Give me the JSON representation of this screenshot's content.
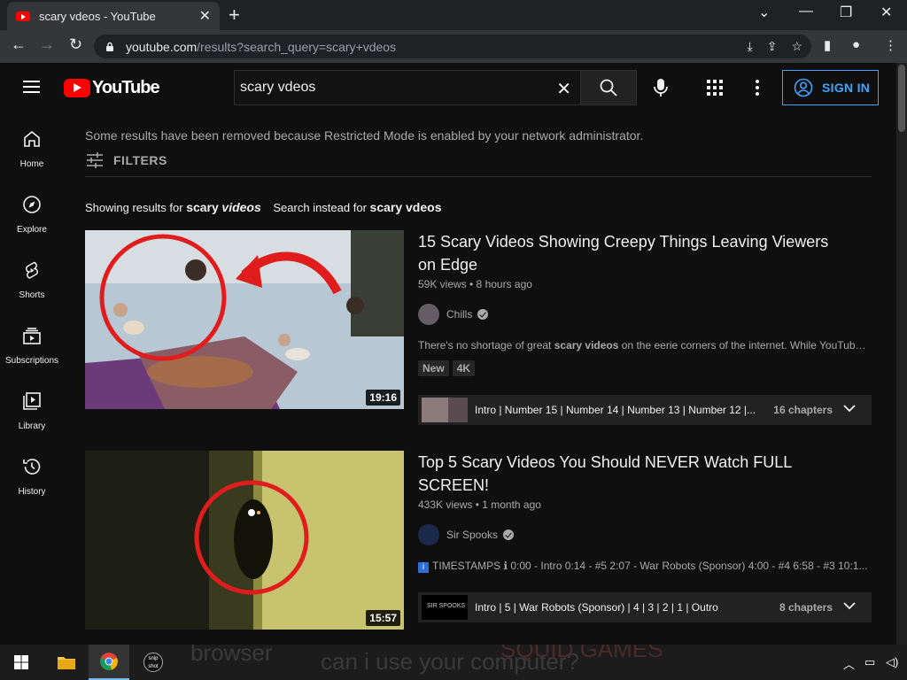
{
  "browser": {
    "tab_title": "scary vdeos - YouTube",
    "url_host": "youtube.com",
    "url_path": "/results?search_query=scary+vdeos"
  },
  "header": {
    "logo_text": "YouTube",
    "search_value": "scary vdeos",
    "sign_in_label": "SIGN IN"
  },
  "sidebar": {
    "items": [
      {
        "label": "Home",
        "icon": "home-icon"
      },
      {
        "label": "Explore",
        "icon": "compass-icon"
      },
      {
        "label": "Shorts",
        "icon": "shorts-icon"
      },
      {
        "label": "Subscriptions",
        "icon": "subscriptions-icon"
      },
      {
        "label": "Library",
        "icon": "library-icon"
      },
      {
        "label": "History",
        "icon": "history-icon"
      }
    ]
  },
  "main": {
    "restricted_notice": "Some results have been removed because Restricted Mode is enabled by your network administrator.",
    "filters_label": "FILTERS",
    "showing_prefix": "Showing results for",
    "showing_query_a": "scary",
    "showing_query_b": "videos",
    "instead_prefix": "Search instead for",
    "instead_query": "scary vdeos"
  },
  "results": [
    {
      "title_line1": "15 Scary Videos Showing Creepy Things Leaving Viewers",
      "title_line2": "on Edge",
      "meta": "59K views • 8 hours ago",
      "channel": "Chills",
      "duration": "19:16",
      "desc_a": "There's no shortage of great ",
      "desc_b": "scary videos",
      "desc_c": " on the eerie corners of the internet. While YouTube le...",
      "badges": [
        "New",
        "4K"
      ],
      "chapters_text": "Intro | Number 15 | Number 14 | Number 13 | Number 12 |...",
      "chapters_count": "16 chapters"
    },
    {
      "title_line1": "Top 5 Scary Videos You Should NEVER Watch FULL",
      "title_line2": "SCREEN!",
      "meta": "433K views • 1 month ago",
      "channel": "Sir Spooks",
      "duration": "15:57",
      "desc_a": "TIMESTAMPS ℹ 0:00 - Intro 0:14 - #5 2:07 - War Robots (Sponsor) 4:00 - #4 6:58 - #3 10:1...",
      "chapters_text": "Intro | 5 | War Robots (Sponsor) | 4 | 3 | 2 | 1 | Outro",
      "chapters_count": "8 chapters",
      "chapters_thumb_text": "SIR SPOOKS"
    }
  ],
  "taskbar": {
    "overlay_text_1": "browser",
    "overlay_text_2": "can i use your computer?",
    "overlay_text_3": "SQUID GAMES",
    "snip_icon_text": "snip shot"
  },
  "colors": {
    "accent_blue": "#3ea6ff",
    "yt_red": "#ff0000",
    "background": "#0f0f0f"
  }
}
